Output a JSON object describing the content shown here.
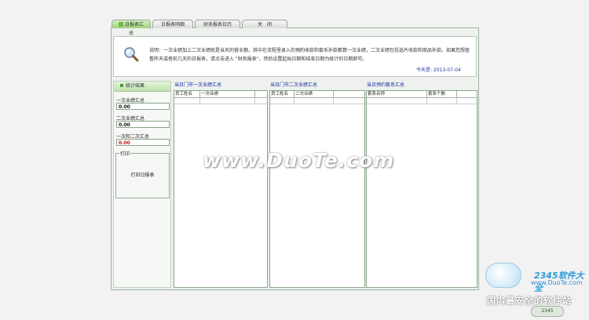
{
  "tabs": [
    {
      "label": "日报表汇总",
      "active": true
    },
    {
      "label": "日报表明细",
      "active": false
    },
    {
      "label": "财务报表日历",
      "active": false
    },
    {
      "label": "关　闭",
      "active": false
    }
  ],
  "info": {
    "description": "说明：一次业绩加上二次业绩就是当天的营业额，其中在流程里录入的預約收款和套系补款都算一次业绩，二次业绩包括选片收款和商品补款。如果您想查看昨天或者前几天的日报表，请点击进入 \"财务报表\"，然后设置起始日期和结束日期为统计的日期即可。",
    "date": "今天是: 2013-07-04"
  },
  "stats": {
    "header": "统计结果",
    "first_label": "一次业绩汇总",
    "first_value": "0.00",
    "second_label": "二次业绩汇总",
    "second_value": "0.00",
    "total_label": "一次和二次汇总",
    "total_value": "0.00",
    "print_legend": "打印",
    "print_button": "打印日报表"
  },
  "panels": [
    {
      "title": "当日门市一次业绩汇总",
      "columns": [
        "员工姓名",
        "一次业绩"
      ]
    },
    {
      "title": "当日门市二次业绩汇总",
      "columns": [
        "员工姓名",
        "二次业绩"
      ]
    },
    {
      "title": "当日预约套系汇总",
      "columns": [
        "套系名称",
        "套系个数"
      ]
    }
  ],
  "watermark": "www.DuoTe.com",
  "corner": {
    "logo_text": "2345软件大全",
    "logo_url": "www.DuoTe.com",
    "slogan": "国内最安全的软件站",
    "badge": "2345"
  }
}
